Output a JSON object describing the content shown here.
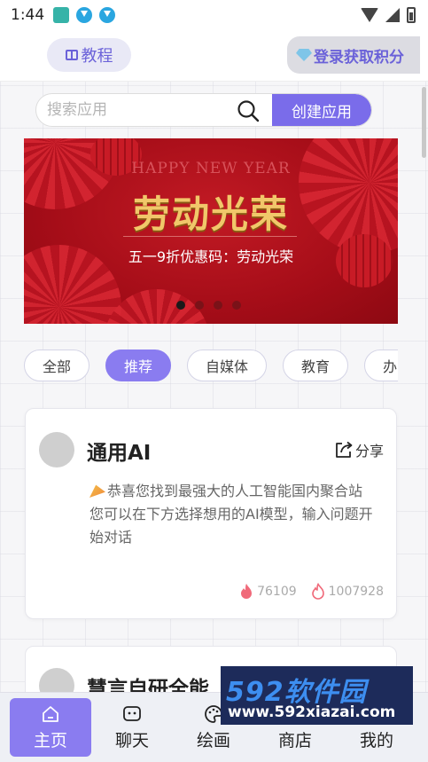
{
  "status_bar": {
    "time": "1:44"
  },
  "header": {
    "tutorial_label": "教程",
    "login_label": "登录获取积分"
  },
  "search": {
    "placeholder": "搜索应用",
    "create_label": "创建应用"
  },
  "banner": {
    "en_text": "HAPPY NEW YEAR",
    "title": "劳动光荣",
    "subtitle": "五一9折优惠码：劳动光荣",
    "dot_count": 4,
    "active_dot": 0
  },
  "categories": [
    {
      "label": "全部",
      "active": false
    },
    {
      "label": "推荐",
      "active": true
    },
    {
      "label": "自媒体",
      "active": false
    },
    {
      "label": "教育",
      "active": false
    },
    {
      "label": "办",
      "active": false
    }
  ],
  "cards": [
    {
      "title": "通用AI",
      "share_label": "分享",
      "description": "恭喜您找到最强大的人工智能国内聚合站 您可以在下方选择想用的AI模型，输入问题开始对话",
      "stat_views": "76109",
      "stat_hot": "1007928"
    },
    {
      "title": "慧言自研全能"
    }
  ],
  "watermark": {
    "logo": "592软件园",
    "url": "www.592xiazai.com"
  },
  "bottom_nav": [
    {
      "label": "主页",
      "active": true,
      "icon": "home-icon"
    },
    {
      "label": "聊天",
      "active": false,
      "icon": "chat-icon"
    },
    {
      "label": "绘画",
      "active": false,
      "icon": "palette-icon"
    },
    {
      "label": "商店",
      "active": false,
      "icon": "store-icon"
    },
    {
      "label": "我的",
      "active": false,
      "icon": "profile-icon"
    }
  ],
  "colors": {
    "accent": "#8a7cf0",
    "create_button": "#7a6cea",
    "banner_red": "#a50d18",
    "banner_gold": "#f1c76a"
  }
}
